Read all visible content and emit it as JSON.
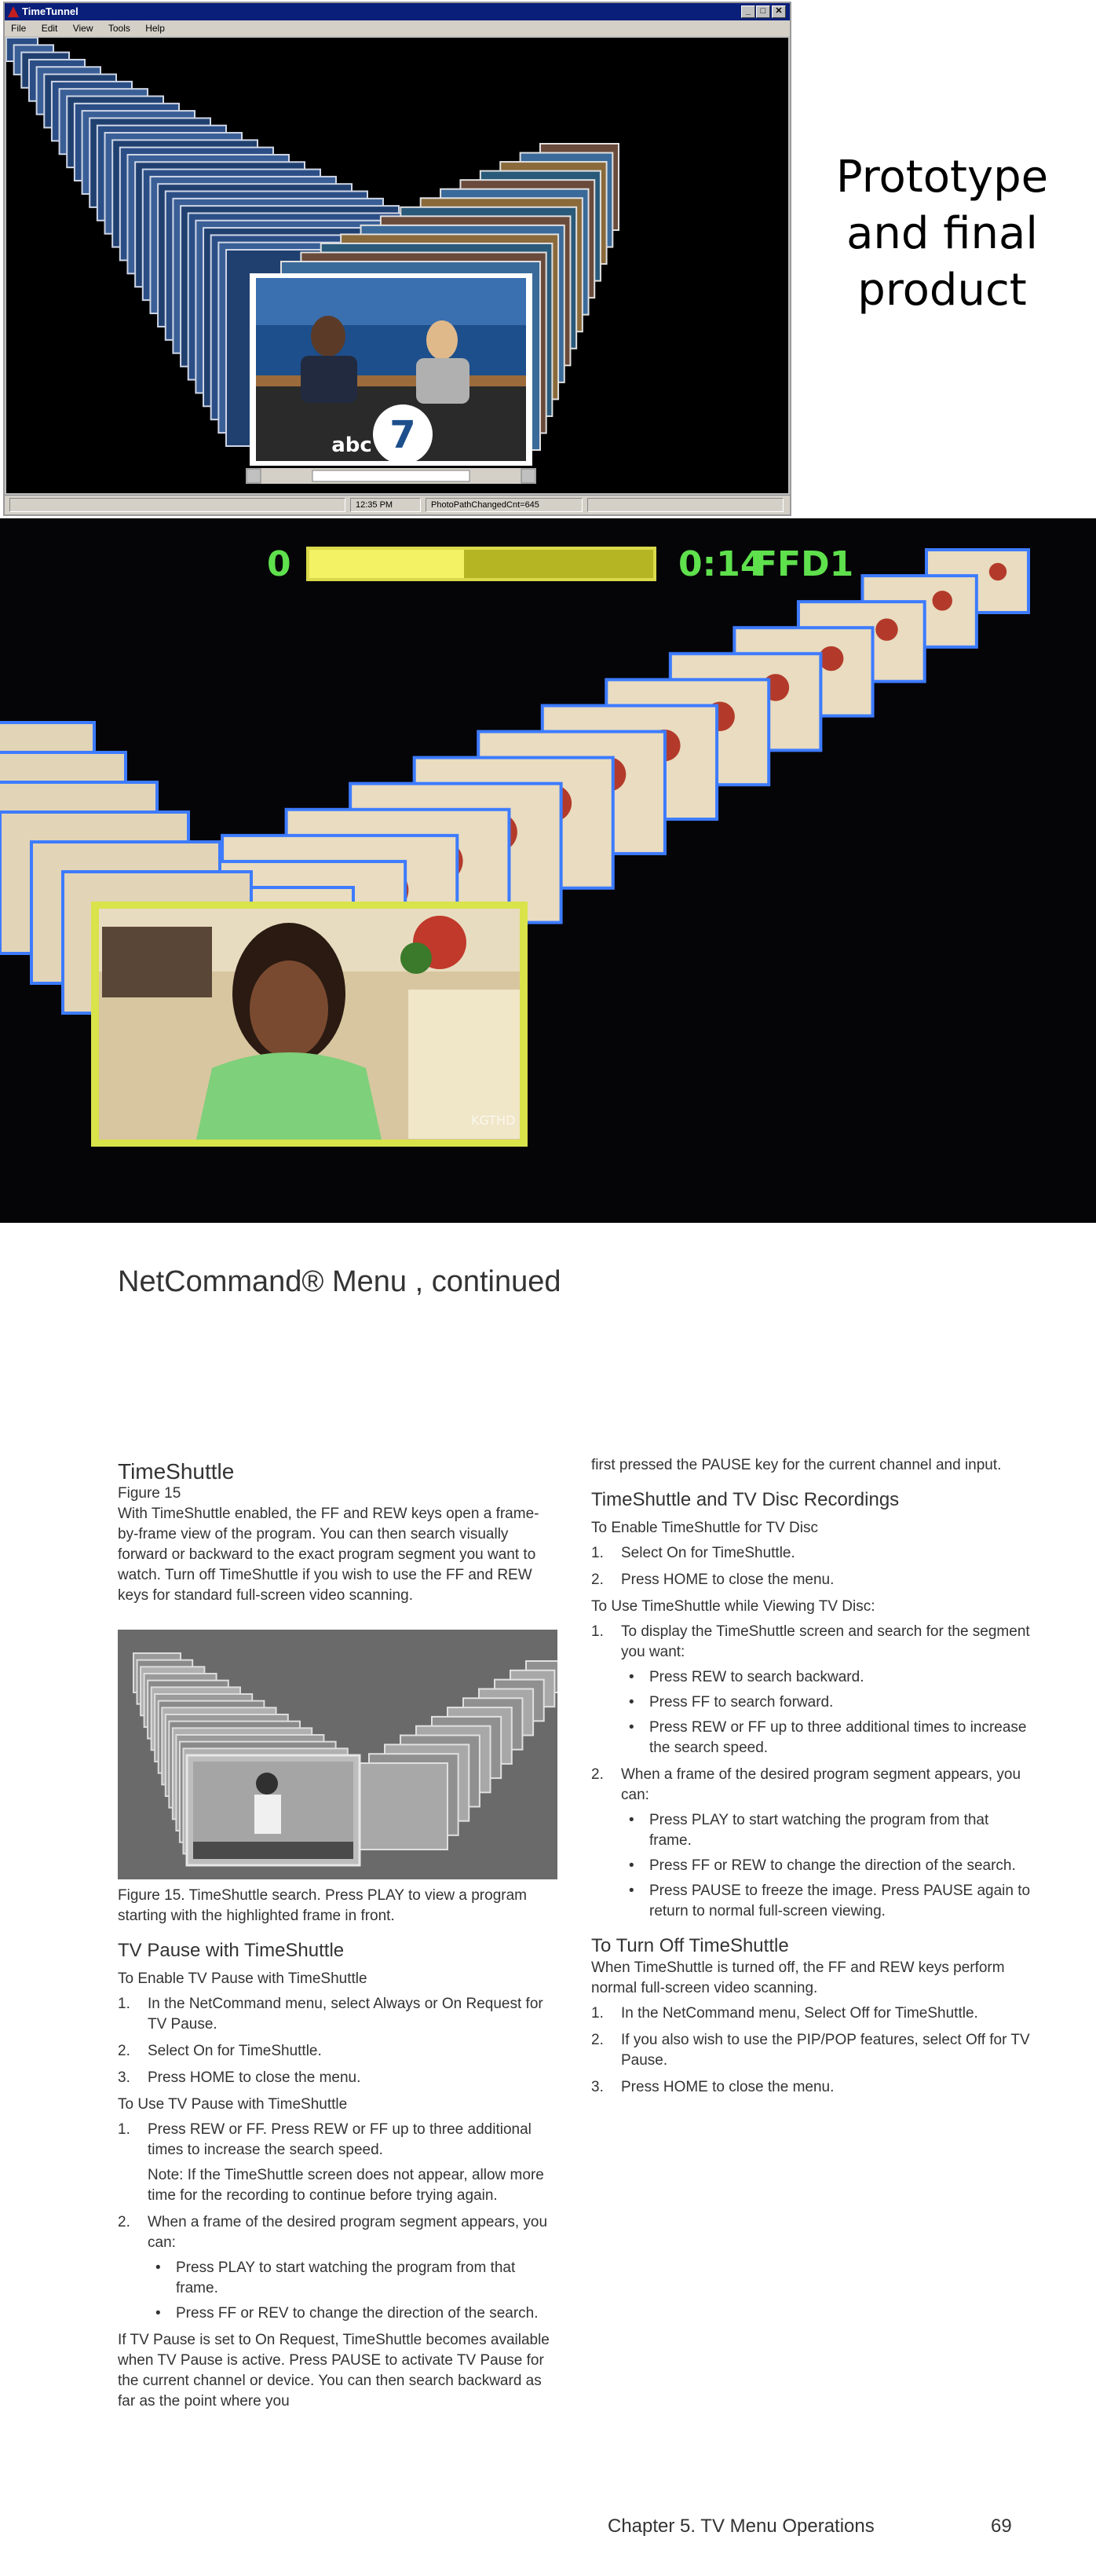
{
  "prototype_window": {
    "title": "TimeTunnel",
    "menu": [
      "File",
      "Edit",
      "View",
      "Tools",
      "Help"
    ],
    "controls": {
      "minimize": "_",
      "maximize": "□",
      "close": "✕"
    },
    "status": {
      "time": "12:35 PM",
      "message": "PhotoPathChangedCnt=645"
    }
  },
  "side_label": {
    "line1": "Prototype",
    "line2": "and final",
    "line3": "product"
  },
  "final_osd": {
    "start": "0",
    "time": "0:14",
    "channel": "FFD1",
    "progress": 0.45
  },
  "manual": {
    "title": "NetCommand® Menu , continued",
    "timeshuttle": {
      "heading": "TimeShuttle",
      "figure_ref": "Figure 15",
      "intro": "With TimeShuttle enabled, the FF and REW keys open a frame-by-frame view of the program.  You can then search visually forward or backward to the exact program segment you want to watch.  Turn off TimeShuttle if you wish to use the FF and REW keys for standard full-screen video scanning.",
      "caption": "Figure 15.  TimeShuttle search.  Press PLAY to view a program starting with the highlighted frame in front."
    },
    "tv_pause": {
      "heading": "TV Pause with TimeShuttle",
      "enable_sub": "To Enable TV Pause with TimeShuttle",
      "enable_steps": [
        {
          "n": "1.",
          "text": "In the NetCommand menu, select Always or On Request for TV Pause."
        },
        {
          "n": "2.",
          "text": "Select On for TimeShuttle."
        },
        {
          "n": "3.",
          "text": "Press HOME to close the menu."
        }
      ],
      "use_sub": "To Use TV Pause with TimeShuttle",
      "use_step1": {
        "n": "1.",
        "text": "Press REW or FF.  Press REW or FF up to three additional times to increase the search speed."
      },
      "use_note": "Note:  If the TimeShuttle screen does not appear, allow more time for the recording to continue before trying again.",
      "use_step2": {
        "n": "2.",
        "text": "When a frame of the desired program segment appears, you can:"
      },
      "use_bullets": [
        "Press PLAY to start watching the program from that frame.",
        "Press FF or REV to change the direction of the search."
      ],
      "closing": "If TV Pause is set to On Request, TimeShuttle becomes available when TV Pause is active.  Press PAUSE to activate TV Pause for the current channel or device.  You can then search backward as far as the point where you",
      "closing_cont": "first pressed the PAUSE key for the current channel and input."
    },
    "disc": {
      "heading": "TimeShuttle and TV Disc Recordings",
      "enable_sub": "To Enable TimeShuttle for TV Disc",
      "enable_steps": [
        {
          "n": "1.",
          "text": "Select On for TimeShuttle."
        },
        {
          "n": "2.",
          "text": "Press HOME to close the menu."
        }
      ],
      "use_sub": "To Use TimeShuttle while Viewing TV Disc:",
      "use_step1": {
        "n": "1.",
        "text": "To display the TimeShuttle screen and search for the segment you want:"
      },
      "use_bullets1": [
        "Press REW to search backward.",
        "Press FF to search forward.",
        "Press REW or FF up to three additional times to increase the search speed."
      ],
      "use_step2": {
        "n": "2.",
        "text": "When a frame of the desired program segment appears, you can:"
      },
      "use_bullets2": [
        "Press PLAY to start watching the program from that frame.",
        "Press FF or REW to change the direction of the search.",
        "Press PAUSE to freeze the image.  Press PAUSE again to return to normal full-screen viewing."
      ]
    },
    "turn_off": {
      "heading": "To Turn Off TimeShuttle",
      "intro": "When TimeShuttle is turned off, the FF and REW keys perform normal full-screen video scanning.",
      "steps": [
        {
          "n": "1.",
          "text": "In the NetCommand menu, Select Off for TimeShuttle."
        },
        {
          "n": "2.",
          "text": "If you also wish to use the PIP/POP features, select Off for TV Pause."
        },
        {
          "n": "3.",
          "text": "Press HOME to close the menu."
        }
      ]
    },
    "footer": {
      "chapter": "Chapter 5. TV Menu Operations",
      "page": "69"
    }
  }
}
